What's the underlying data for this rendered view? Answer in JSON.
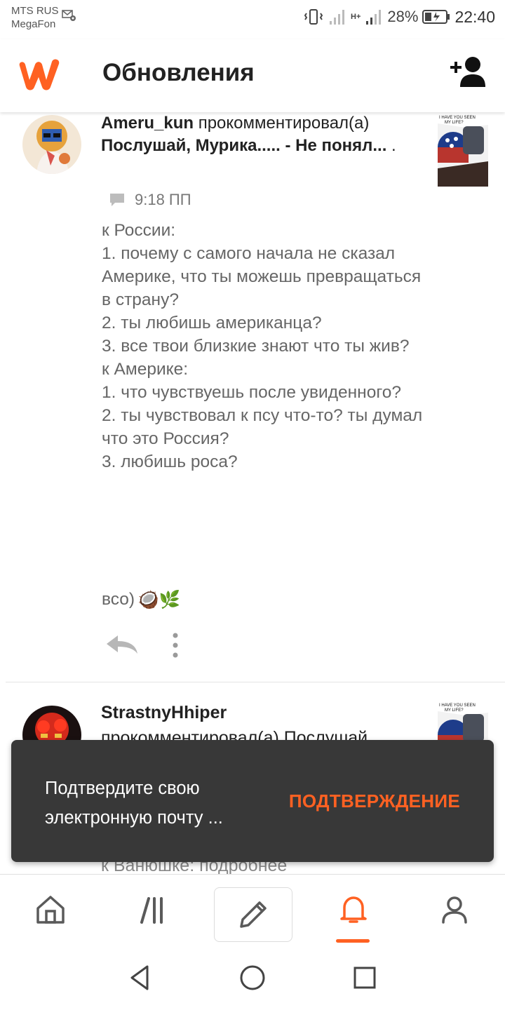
{
  "status_bar": {
    "carrier_1": "MTS RUS",
    "carrier_2": "MegaFon",
    "network": "H+",
    "battery": "28%",
    "time": "22:40"
  },
  "app_bar": {
    "title": "Обновления",
    "logo_icon": "wattpad-logo-icon",
    "add_icon": "add-user-icon"
  },
  "colors": {
    "accent": "#ff6122",
    "snackbar_bg": "#383838"
  },
  "notifications": [
    {
      "user": "Ameru_kun",
      "action": " прокомментировал(а) ",
      "story": "Послушай, Мурика..... - Не понял...",
      "suffix": " .",
      "time": "9:18 ПП",
      "comment": "к России:\n1. почему с самого начала не сказал Америке, что ты можешь превращаться в страну?\n2. ты любишь американца?\n3. все твои близкие знают что ты жив?\nк Америке:\n1. что чувствуешь после увиденного?\n2. ты чувствовал к псу что-то? ты думал что это Россия?\n3. любишь роса?",
      "sign": "всо)",
      "sign_emoji": "🥥🌿"
    },
    {
      "user": "StrastnyHhiper",
      "action": "прокомментировал(а) Послушай",
      "comment_start": "к Ванюшке: подробнее"
    }
  ],
  "snackbar": {
    "message": "Подтвердите свою электронную почту ...",
    "action": "ПОДТВЕРЖДЕНИЕ"
  },
  "bottom_nav": [
    "home-icon",
    "library-icon",
    "write-icon",
    "notifications-icon",
    "profile-icon"
  ],
  "system_nav": [
    "back-icon",
    "home-circle-icon",
    "recents-icon"
  ]
}
